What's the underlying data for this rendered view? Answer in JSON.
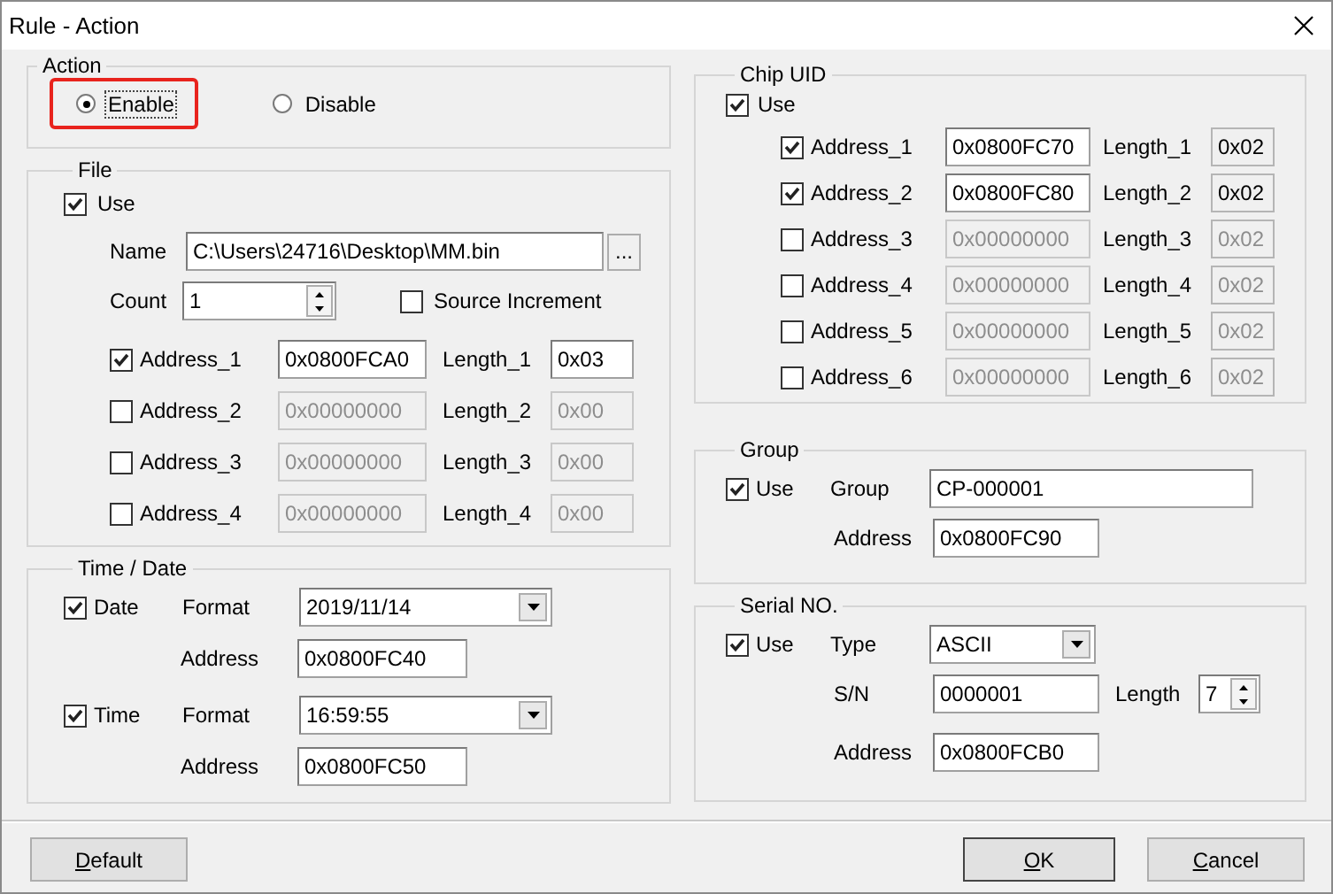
{
  "window": {
    "title": "Rule - Action"
  },
  "action": {
    "title": "Action",
    "options": [
      {
        "label": "Enable",
        "selected": true,
        "highlighted": true
      },
      {
        "label": "Disable",
        "selected": false,
        "highlighted": false
      }
    ]
  },
  "file": {
    "title": "File",
    "use": {
      "label": "Use",
      "checked": true
    },
    "name_label": "Name",
    "name": "C:\\Users\\24716\\Desktop\\MM.bin",
    "browse": "...",
    "count_label": "Count",
    "count": "1",
    "source_increment": {
      "label": "Source Increment",
      "checked": false
    },
    "addresses": [
      {
        "label": "Address_1",
        "checked": true,
        "value": "0x0800FCA0",
        "length_label": "Length_1",
        "length": "0x03"
      },
      {
        "label": "Address_2",
        "checked": false,
        "value": "0x00000000",
        "length_label": "Length_2",
        "length": "0x00"
      },
      {
        "label": "Address_3",
        "checked": false,
        "value": "0x00000000",
        "length_label": "Length_3",
        "length": "0x00"
      },
      {
        "label": "Address_4",
        "checked": false,
        "value": "0x00000000",
        "length_label": "Length_4",
        "length": "0x00"
      }
    ]
  },
  "time_date": {
    "title": "Time / Date",
    "rows": [
      {
        "label": "Date",
        "checked": true,
        "format_label": "Format",
        "format": "2019/11/14",
        "address_label": "Address",
        "address": "0x0800FC40"
      },
      {
        "label": "Time",
        "checked": true,
        "format_label": "Format",
        "format": "16:59:55",
        "address_label": "Address",
        "address": "0x0800FC50"
      }
    ]
  },
  "chip_uid": {
    "title": "Chip UID",
    "use": {
      "label": "Use",
      "checked": true
    },
    "addresses": [
      {
        "label": "Address_1",
        "checked": true,
        "value": "0x0800FC70",
        "length_label": "Length_1",
        "length": "0x02"
      },
      {
        "label": "Address_2",
        "checked": true,
        "value": "0x0800FC80",
        "length_label": "Length_2",
        "length": "0x02"
      },
      {
        "label": "Address_3",
        "checked": false,
        "value": "0x00000000",
        "length_label": "Length_3",
        "length": "0x02"
      },
      {
        "label": "Address_4",
        "checked": false,
        "value": "0x00000000",
        "length_label": "Length_4",
        "length": "0x02"
      },
      {
        "label": "Address_5",
        "checked": false,
        "value": "0x00000000",
        "length_label": "Length_5",
        "length": "0x02"
      },
      {
        "label": "Address_6",
        "checked": false,
        "value": "0x00000000",
        "length_label": "Length_6",
        "length": "0x02"
      }
    ]
  },
  "group": {
    "title": "Group",
    "use": {
      "label": "Use",
      "checked": true
    },
    "group_label": "Group",
    "group": "CP-000001",
    "address_label": "Address",
    "address": "0x0800FC90"
  },
  "serial": {
    "title": "Serial NO.",
    "use": {
      "label": "Use",
      "checked": true
    },
    "type_label": "Type",
    "type": "ASCII",
    "sn_label": "S/N",
    "sn": "0000001",
    "length_label": "Length",
    "length": "7",
    "address_label": "Address",
    "address": "0x0800FCB0"
  },
  "buttons": [
    {
      "label": "Default",
      "mnemonic": true,
      "default": false
    },
    {
      "label": "OK",
      "mnemonic": true,
      "default": true
    },
    {
      "label": "Cancel",
      "mnemonic": true,
      "default": false
    }
  ]
}
